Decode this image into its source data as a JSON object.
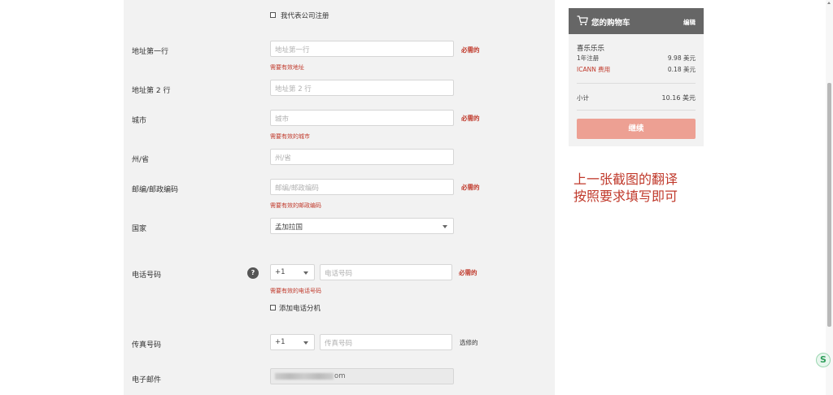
{
  "form": {
    "register_company_label": "我代表公司注册",
    "address1": {
      "label": "地址第一行",
      "placeholder": "地址第一行",
      "required": "必需的",
      "error": "需要有效地址"
    },
    "address2": {
      "label": "地址第 2 行",
      "placeholder": "地址第 2 行"
    },
    "city": {
      "label": "城市",
      "placeholder": "城市",
      "required": "必需的",
      "error": "需要有效的城市"
    },
    "state": {
      "label": "州/省",
      "placeholder": "州/省"
    },
    "postcode": {
      "label": "邮编/邮政编码",
      "placeholder": "邮编/邮政编码",
      "required": "必需的",
      "error": "需要有效的邮政编码"
    },
    "country": {
      "label": "国家",
      "value": "孟加拉国"
    },
    "phone": {
      "label": "电话号码",
      "help": "?",
      "code": "+1",
      "placeholder": "电话号码",
      "required": "必需的",
      "error": "需要有效的电话号码",
      "add_extension": "添加电话分机"
    },
    "fax": {
      "label": "传真号码",
      "code": "+1",
      "placeholder": "传真号码",
      "optional": "选修的"
    },
    "email": {
      "label": "电子邮件",
      "visible_suffix": "om"
    }
  },
  "cart": {
    "title": "您的购物车",
    "edit": "编辑",
    "item_name": "喜乐乐乐",
    "item_term": "1年注册",
    "item_price": "9.98 美元",
    "icann_label": "ICANN 费用",
    "icann_price": "0.18 美元",
    "subtotal_label": "小计",
    "subtotal_value": "10.16 美元",
    "continue": "继续"
  },
  "note": {
    "line1": "上一张截图的翻译",
    "line2": "按照要求填写即可"
  },
  "floating_button": "S",
  "colors": {
    "accent_red": "#c0392b",
    "cart_header": "#666666",
    "continue_button": "#eda093",
    "panel_bg": "#f2f2f2"
  }
}
